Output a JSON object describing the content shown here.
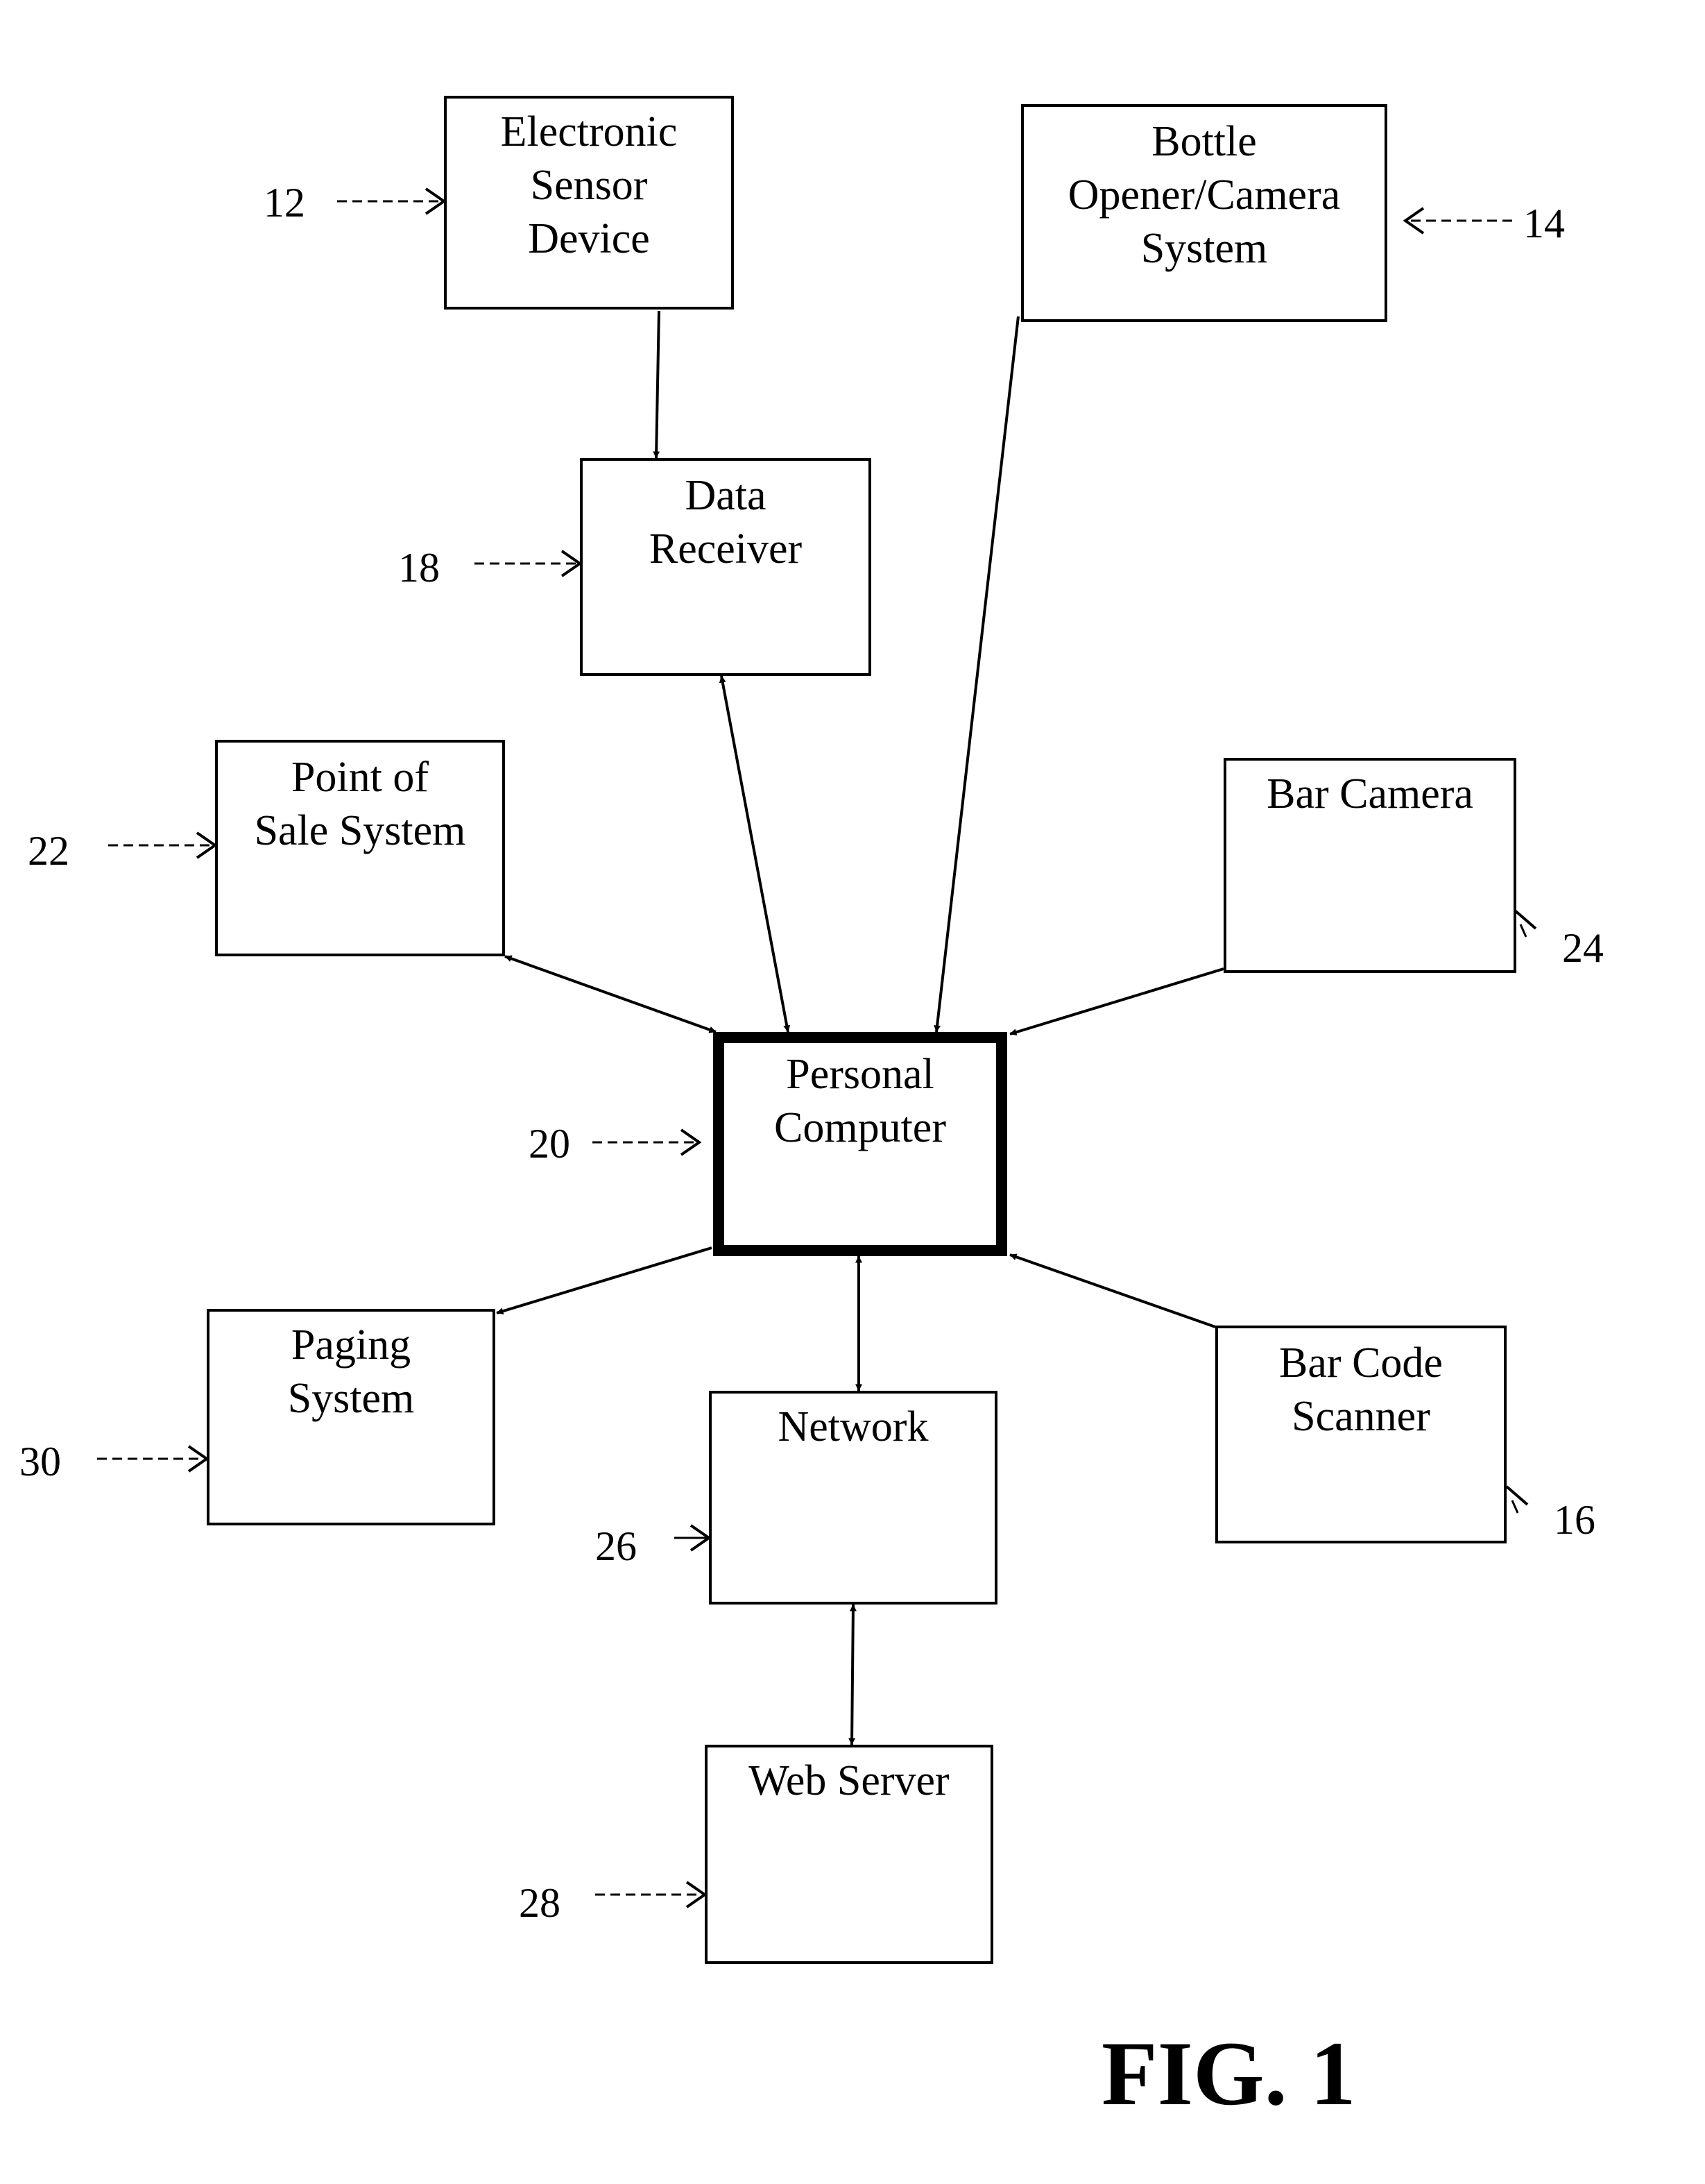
{
  "figure": {
    "title": "FIG. 1",
    "type": "block-diagram"
  },
  "nodes": [
    {
      "id": "electronic-sensor-device",
      "lines": [
        "Electronic",
        "Sensor",
        "Device"
      ],
      "ref": "12"
    },
    {
      "id": "bottle-opener-camera-system",
      "lines": [
        "Bottle",
        "Opener/Camera",
        "System"
      ],
      "ref": "14"
    },
    {
      "id": "data-receiver",
      "lines": [
        "Data",
        "Receiver"
      ],
      "ref": "18"
    },
    {
      "id": "point-of-sale-system",
      "lines": [
        "Point of",
        "Sale System"
      ],
      "ref": "22"
    },
    {
      "id": "bar-camera",
      "lines": [
        "Bar Camera"
      ],
      "ref": "24"
    },
    {
      "id": "personal-computer",
      "lines": [
        "Personal",
        "Computer"
      ],
      "ref": "20",
      "emphasis": "thick-border"
    },
    {
      "id": "paging-system",
      "lines": [
        "Paging",
        "System"
      ],
      "ref": "30"
    },
    {
      "id": "network",
      "lines": [
        "Network"
      ],
      "ref": "26"
    },
    {
      "id": "bar-code-scanner",
      "lines": [
        "Bar Code",
        "Scanner"
      ],
      "ref": "16"
    },
    {
      "id": "web-server",
      "lines": [
        "Web Server"
      ],
      "ref": "28"
    }
  ],
  "connections": [
    {
      "from": "electronic-sensor-device",
      "to": "data-receiver",
      "direction": "one-way"
    },
    {
      "from": "data-receiver",
      "to": "personal-computer",
      "direction": "two-way"
    },
    {
      "from": "bottle-opener-camera-system",
      "to": "personal-computer",
      "direction": "one-way"
    },
    {
      "from": "point-of-sale-system",
      "to": "personal-computer",
      "direction": "two-way"
    },
    {
      "from": "bar-camera",
      "to": "personal-computer",
      "direction": "one-way"
    },
    {
      "from": "personal-computer",
      "to": "paging-system",
      "direction": "one-way"
    },
    {
      "from": "personal-computer",
      "to": "network",
      "direction": "two-way"
    },
    {
      "from": "bar-code-scanner",
      "to": "personal-computer",
      "direction": "one-way"
    },
    {
      "from": "network",
      "to": "web-server",
      "direction": "two-way"
    }
  ]
}
